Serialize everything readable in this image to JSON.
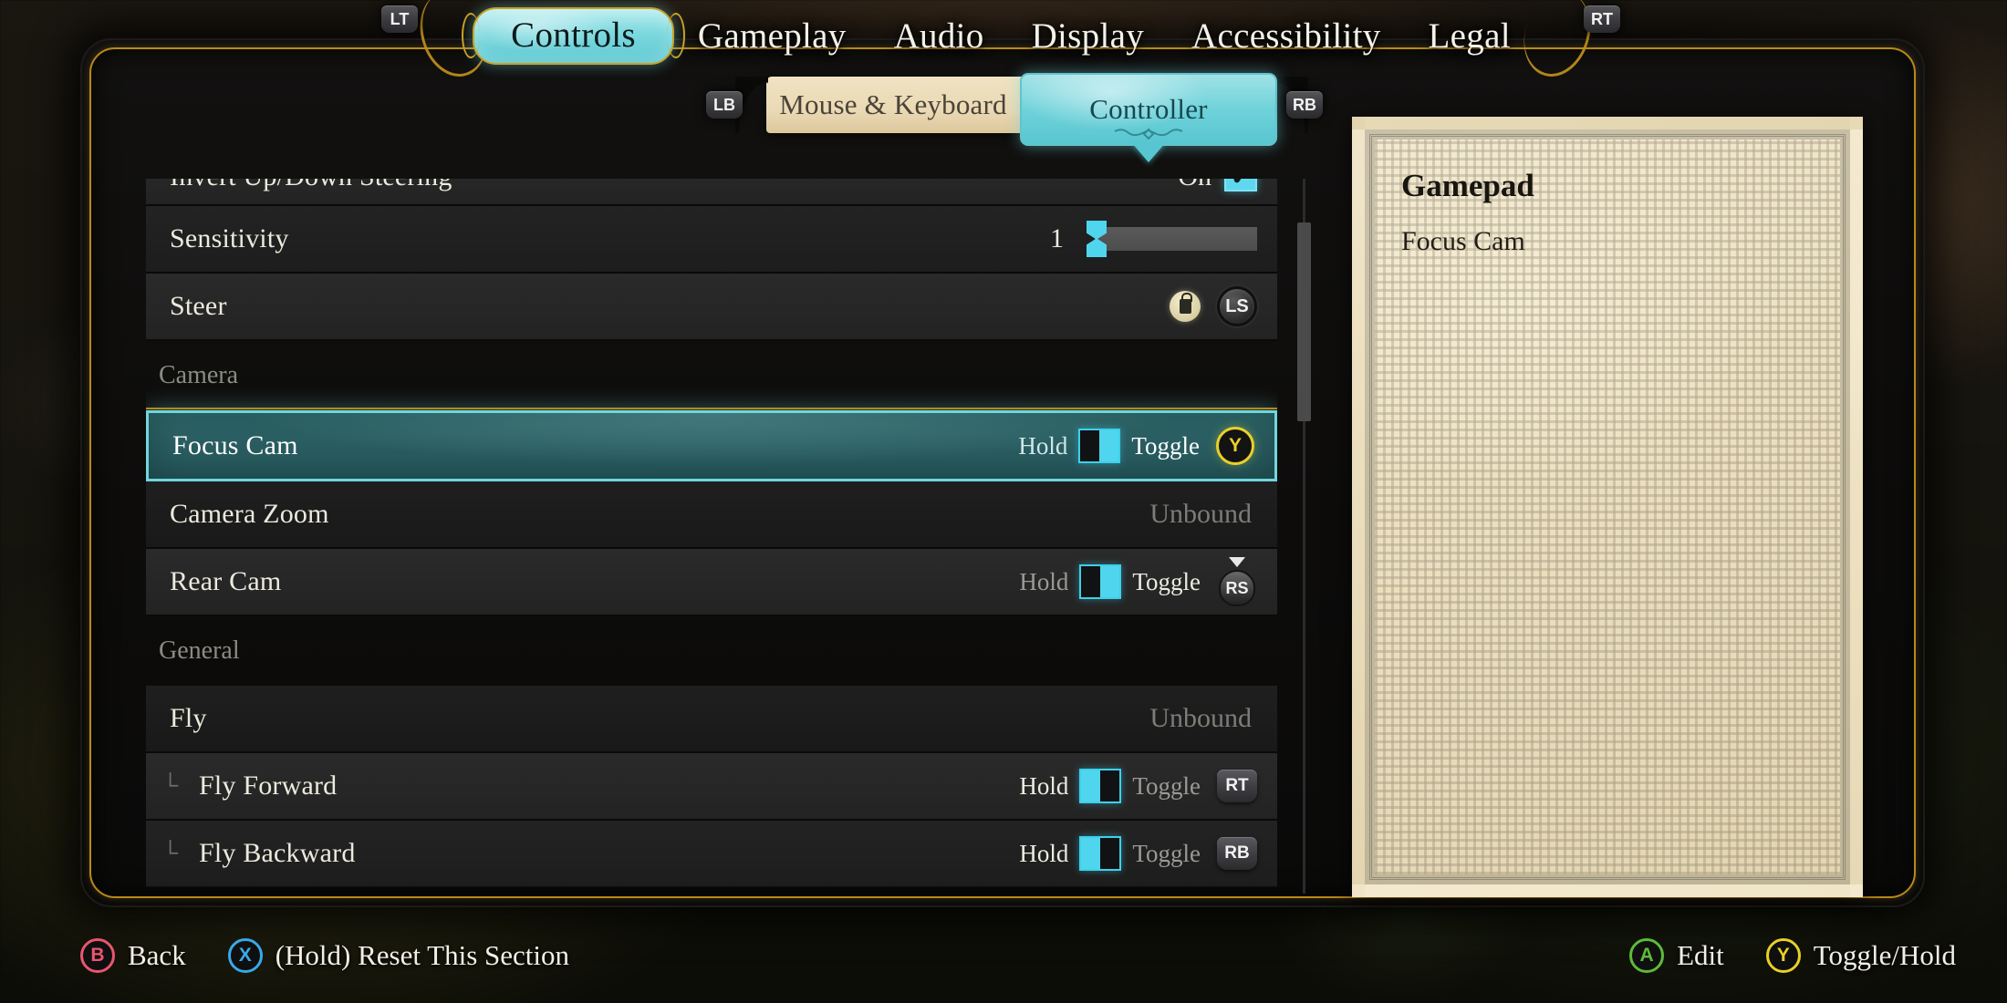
{
  "nav": {
    "left_shoulder_key": "LT",
    "right_shoulder_key": "RT",
    "tabs": [
      {
        "label": "Controls",
        "selected": true
      },
      {
        "label": "Gameplay",
        "selected": false
      },
      {
        "label": "Audio",
        "selected": false
      },
      {
        "label": "Display",
        "selected": false
      },
      {
        "label": "Accessibility",
        "selected": false
      },
      {
        "label": "Legal",
        "selected": false
      }
    ]
  },
  "subnav": {
    "left_bumper_key": "LB",
    "right_bumper_key": "RB",
    "tabs": [
      {
        "label": "Mouse & Keyboard",
        "selected": false
      },
      {
        "label": "Controller",
        "selected": true
      }
    ]
  },
  "settings": {
    "rows": [
      {
        "kind": "checkbox",
        "label": "Invert Up/Down Steering",
        "value_text": "On",
        "checkmark": "✔",
        "partial_top": true
      },
      {
        "kind": "slider",
        "label": "Sensitivity",
        "value": "1",
        "min": 1,
        "max": 10,
        "fill_percent": 0
      },
      {
        "kind": "binding",
        "label": "Steer",
        "locked": true,
        "lock_icon": "lock-icon",
        "binding_glyph": "LS"
      },
      {
        "kind": "section",
        "label": "Camera"
      },
      {
        "kind": "holdtoggle",
        "label": "Focus Cam",
        "hold_label": "Hold",
        "toggle_label": "Toggle",
        "mode": "Toggle",
        "binding_glyph": "Y",
        "binding_style": "face-button-y",
        "highlighted": true
      },
      {
        "kind": "unbound",
        "label": "Camera Zoom",
        "value_text": "Unbound"
      },
      {
        "kind": "holdtoggle",
        "label": "Rear Cam",
        "hold_label": "Hold",
        "toggle_label": "Toggle",
        "mode": "Toggle",
        "binding_glyph": "RS",
        "binding_style": "stick-press"
      },
      {
        "kind": "section",
        "label": "General"
      },
      {
        "kind": "unbound",
        "label": "Fly",
        "value_text": "Unbound"
      },
      {
        "kind": "holdtoggle",
        "label": "Fly Forward",
        "indent": "└",
        "hold_label": "Hold",
        "toggle_label": "Toggle",
        "mode": "Hold",
        "binding_glyph": "RT",
        "binding_style": "bumper"
      },
      {
        "kind": "holdtoggle",
        "label": "Fly Backward",
        "indent": "└",
        "hold_label": "Hold",
        "toggle_label": "Toggle",
        "mode": "Hold",
        "binding_glyph": "RB",
        "binding_style": "bumper"
      }
    ]
  },
  "detail_panel": {
    "title": "Gamepad",
    "subtitle": "Focus Cam"
  },
  "footer": {
    "left_prompts": [
      {
        "button": "B",
        "label": "Back",
        "color": "#e8566f"
      },
      {
        "button": "X",
        "label": "(Hold) Reset This Section",
        "color": "#39a9e8"
      }
    ],
    "right_prompts": [
      {
        "button": "A",
        "label": "Edit",
        "color": "#5dbb3a"
      },
      {
        "button": "Y",
        "label": "Toggle/Hold",
        "color": "#e8d02a"
      }
    ]
  },
  "colors": {
    "accent_cyan": "#5fd8ef",
    "accent_gold": "#b8891a",
    "parchment": "#ece0c0",
    "row_bg": "#262626"
  }
}
